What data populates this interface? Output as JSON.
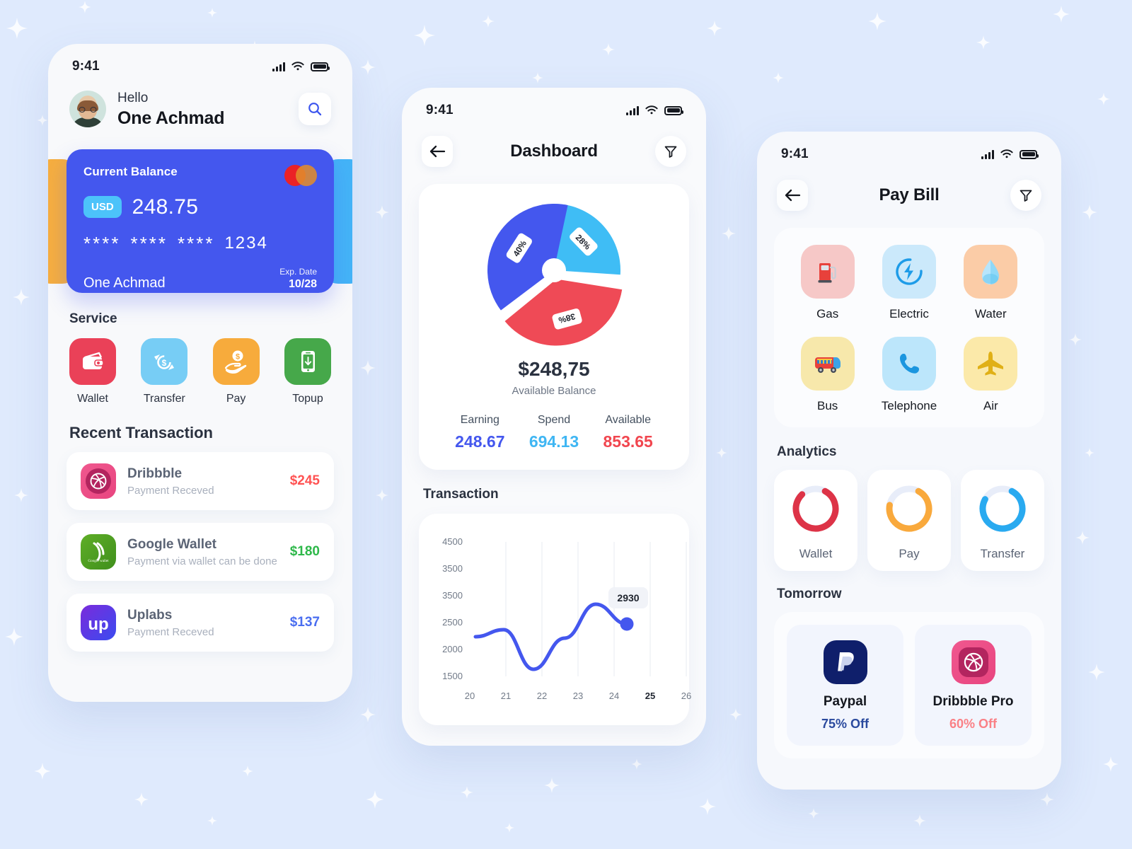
{
  "background": {
    "color": "#dfeafd",
    "sparkle_color": "#ffffff"
  },
  "phone_home": {
    "status": {
      "time": "9:41",
      "signal_icon": "cellular-bars-icon",
      "wifi_icon": "wifi-icon",
      "battery_icon": "battery-icon"
    },
    "greeting": "Hello",
    "user_name": "One Achmad",
    "search_icon": "search-icon",
    "card": {
      "label": "Current Balance",
      "currency": "USD",
      "amount": "248.75",
      "masked_1": "****",
      "masked_2": "****",
      "masked_3": "****",
      "last4": "1234",
      "holder": "One Achmad",
      "exp_label": "Exp. Date",
      "exp_value": "10/28",
      "brand_icon": "mastercard-icon",
      "color": "#4457ee",
      "peek_left_color": "#f6ae3f",
      "peek_right_color": "#44b4f7"
    },
    "service_title": "Service",
    "services": [
      {
        "label": "Wallet",
        "icon": "wallet-icon",
        "color": "#ea4158"
      },
      {
        "label": "Transfer",
        "icon": "transfer-icon",
        "color": "#77cdf5"
      },
      {
        "label": "Pay",
        "icon": "hand-coin-icon",
        "color": "#f7ab3c"
      },
      {
        "label": "Topup",
        "icon": "phone-topup-icon",
        "color": "#46a84a"
      }
    ],
    "transactions_title": "Recent Transaction",
    "transactions": [
      {
        "name": "Dribbble",
        "sub": "Payment Receved",
        "amount": "$245",
        "amount_color": "#ff5252",
        "icon": "dribbble-icon",
        "icon_color": "#ec4e8c"
      },
      {
        "name": "Google Wallet",
        "sub": "Payment via wallet can be done",
        "amount": "$180",
        "amount_color": "#2eb84a",
        "icon": "google-wallet-icon",
        "icon_color": "#53a626"
      },
      {
        "name": "Uplabs",
        "sub": "Payment Receved",
        "amount": "$137",
        "amount_color": "#4a6ef0",
        "icon": "uplabs-icon",
        "icon_color": "#4b35d6"
      }
    ]
  },
  "phone_dashboard": {
    "status": {
      "time": "9:41"
    },
    "back_icon": "arrow-left-icon",
    "title": "Dashboard",
    "filter_icon": "filter-icon",
    "balance_amount": "$248,75",
    "balance_label": "Available Balance",
    "stats": [
      {
        "key": "Earning",
        "value": "248.67",
        "color": "#4457ee"
      },
      {
        "key": "Spend",
        "value": "694.13",
        "color": "#3fb6f3"
      },
      {
        "key": "Available",
        "value": "853.65",
        "color": "#f1464f"
      }
    ],
    "transaction_title": "Transaction",
    "tooltip_value": "2930"
  },
  "phone_paybill": {
    "status": {
      "time": "9:41"
    },
    "back_icon": "arrow-left-icon",
    "title": "Pay Bill",
    "filter_icon": "filter-icon",
    "bills": [
      {
        "label": "Gas",
        "icon": "fuel-pump-icon",
        "bg": "#f6c8c7"
      },
      {
        "label": "Electric",
        "icon": "bolt-icon",
        "bg": "#cbe9fb"
      },
      {
        "label": "Water",
        "icon": "water-drop-icon",
        "bg": "#fbcca7"
      },
      {
        "label": "Bus",
        "icon": "bus-icon",
        "bg": "#f7e8ab"
      },
      {
        "label": "Telephone",
        "icon": "phone-icon",
        "bg": "#bce6fb"
      },
      {
        "label": "Air",
        "icon": "airplane-icon",
        "bg": "#fbe9a9"
      }
    ],
    "analytics_title": "Analytics",
    "analytics": [
      {
        "label": "Wallet",
        "percent": 80,
        "color": "#dd3347"
      },
      {
        "label": "Pay",
        "percent": 70,
        "color": "#f9a93c"
      },
      {
        "label": "Transfer",
        "percent": 75,
        "color": "#29aaf0"
      }
    ],
    "tomorrow_title": "Tomorrow",
    "offers": [
      {
        "name": "Paypal",
        "discount": "75% Off",
        "discount_color": "#2b4a9e",
        "icon": "paypal-icon",
        "icon_bg": "#0f1f6b"
      },
      {
        "name": "Dribbble Pro",
        "discount": "60% Off",
        "discount_color": "#fa8086",
        "icon": "dribbble-icon",
        "icon_bg": "#ec4e8c"
      }
    ]
  },
  "chart_data": [
    {
      "type": "pie",
      "title": "Balance breakdown",
      "categories": [
        "Earning",
        "Available",
        "Spend"
      ],
      "values": [
        40,
        38,
        28
      ],
      "labels": [
        "40%",
        "38%",
        "28%"
      ],
      "colors": [
        "#4457ee",
        "#ef4a56",
        "#3fbdf5"
      ],
      "exploded": [
        "Available"
      ],
      "donut_hole": true,
      "legend": "none"
    },
    {
      "type": "line",
      "title": "Transaction",
      "x": [
        20,
        21,
        22,
        23,
        24,
        25,
        26
      ],
      "xticklabels": [
        "20",
        "21",
        "22",
        "23",
        "24",
        "25",
        "26"
      ],
      "highlight_x": "25",
      "yticklabels": [
        "4500",
        "3500",
        "3500",
        "2500",
        "2000",
        "1500"
      ],
      "ylim": [
        1200,
        4800
      ],
      "values": [
        2700,
        2790,
        1800,
        2600,
        3760,
        2930,
        null
      ],
      "marker_label": "2930",
      "line_color": "#4457ee",
      "grid": true,
      "legend": "none"
    },
    {
      "type": "pie",
      "title": "Analytics donuts",
      "categories": [
        "Wallet",
        "Pay",
        "Transfer"
      ],
      "values": [
        80,
        70,
        75
      ],
      "colors": [
        "#dd3347",
        "#f9a93c",
        "#29aaf0"
      ],
      "track_color": "#e8edf9",
      "donut_hole": true,
      "legend": "bottom"
    }
  ]
}
